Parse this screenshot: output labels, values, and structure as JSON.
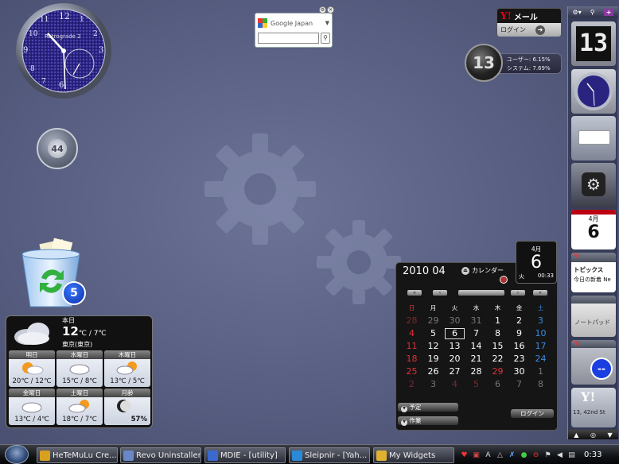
{
  "clock": {
    "brand": "Retrograde 2",
    "numbers": [
      "12",
      "1",
      "2",
      "3",
      "4",
      "5",
      "6",
      "7",
      "8",
      "9",
      "10",
      "11"
    ]
  },
  "google": {
    "title": "Google Japan",
    "search_placeholder": "",
    "search_glyph": "⚲"
  },
  "yahoo_mail": {
    "logo": "Y!",
    "title": "メール",
    "login": "ログイン",
    "arrow": "➜"
  },
  "cpu_meter": {
    "value": "13",
    "user_label": "ユーザー: 6.15%",
    "system_label": "システム: 7.69%"
  },
  "volume": {
    "value": "44"
  },
  "recycle_bin": {
    "count": "5"
  },
  "weather": {
    "today_label": "本日",
    "today_high": "12",
    "today_low": "7℃",
    "today_unit": "℃ / ",
    "location": "東京(東京)",
    "forecast": [
      {
        "day": "明日",
        "temp": "20℃ / 12℃",
        "icon": "sun-cloud"
      },
      {
        "day": "水曜日",
        "temp": "15℃ / 8℃",
        "icon": "cloud"
      },
      {
        "day": "木曜日",
        "temp": "13℃ / 5℃",
        "icon": "cloud-sun"
      },
      {
        "day": "金曜日",
        "temp": "13℃ / 4℃",
        "icon": "cloud"
      },
      {
        "day": "土曜日",
        "temp": "18℃ / 7℃",
        "icon": "cloud-sun"
      },
      {
        "day": "月齢",
        "temp": "57%",
        "icon": "moon"
      }
    ]
  },
  "date_tile": {
    "month": "4月",
    "day": "6",
    "weekday": "火",
    "time": "00:33"
  },
  "calendar": {
    "year_month": "2010 04",
    "label": "カレンダー",
    "nav": [
      "«",
      "‹",
      "",
      "›",
      "»"
    ],
    "weekdays": [
      "日",
      "月",
      "火",
      "水",
      "木",
      "金",
      "土"
    ],
    "weeks": [
      [
        "28",
        "29",
        "30",
        "31",
        "1",
        "2",
        "3"
      ],
      [
        "4",
        "5",
        "6",
        "7",
        "8",
        "9",
        "10"
      ],
      [
        "11",
        "12",
        "13",
        "14",
        "15",
        "16",
        "17"
      ],
      [
        "18",
        "19",
        "20",
        "21",
        "22",
        "23",
        "24"
      ],
      [
        "25",
        "26",
        "27",
        "28",
        "29",
        "30",
        "1"
      ],
      [
        "2",
        "3",
        "4",
        "5",
        "6",
        "7",
        "8"
      ]
    ],
    "schedule_btn": "予定",
    "create_btn": "作業",
    "login_btn": "ログイン"
  },
  "sidebar": {
    "tile_numbers": "13",
    "tile_calendar_month": "4月",
    "tile_calendar_day": "6",
    "tile_topics_label": "トピックス",
    "tile_topics_sub": "今日の新着 Ne",
    "tile_notepad_label": "ノートパッド",
    "tile_mail_badge": "--",
    "tile_weather_temp": "13, 42nd St",
    "yahoo_logo": "Y!"
  },
  "taskbar": {
    "tasks": [
      {
        "label": "HeTeMuLu Cre...",
        "color": "#d8a020"
      },
      {
        "label": "Revo Uninstaller",
        "color": "#6a88c8"
      },
      {
        "label": "MDIE - [utility]",
        "color": "#3a6ad0"
      },
      {
        "label": "Sleipnir - [Yah...",
        "color": "#2b8ad8"
      },
      {
        "label": "My Widgets",
        "color": "#e0b030"
      }
    ],
    "tray_time": "0:33",
    "tray_ime": "A"
  },
  "colors": {
    "accent_red": "#e0303a",
    "accent_blue": "#4a8bd8",
    "sunday": "#e0303a",
    "saturday": "#3a8be0"
  }
}
